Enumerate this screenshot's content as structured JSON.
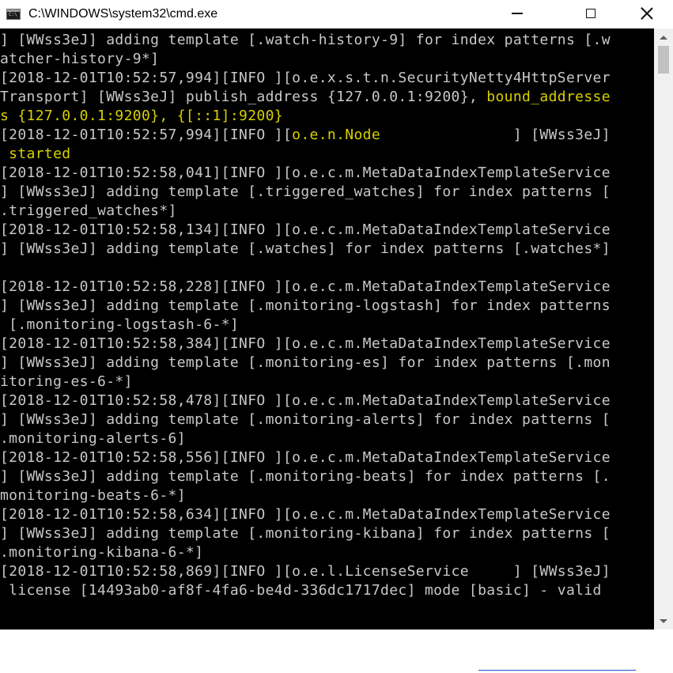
{
  "window": {
    "title": "C:\\WINDOWS\\system32\\cmd.exe",
    "icon": "cmd-icon",
    "controls": {
      "minimize": "minimize-icon",
      "maximize": "maximize-icon",
      "close": "close-icon"
    }
  },
  "colors": {
    "console_bg": "#000000",
    "console_text": "#c8c8c8",
    "highlight_text": "#d8d000"
  },
  "console": {
    "lines": [
      [
        {
          "text": "] [WWss3eJ] adding template [.watch-history-9] for index patterns [.w",
          "hl": false
        }
      ],
      [
        {
          "text": "atcher-history-9*]",
          "hl": false
        }
      ],
      [
        {
          "text": "[2018-12-01T10:52:57,994][INFO ][o.e.x.s.t.n.SecurityNetty4HttpServer",
          "hl": false
        }
      ],
      [
        {
          "text": "Transport] [WWss3eJ] publish_address {127.0.0.1:9200}, ",
          "hl": false
        },
        {
          "text": "bound_addresse",
          "hl": true
        }
      ],
      [
        {
          "text": "s {127.0.0.1:9200}, {[::1]:9200}",
          "hl": true
        }
      ],
      [
        {
          "text": "[2018-12-01T10:52:57,994][INFO ][",
          "hl": false
        },
        {
          "text": "o.e.n.Node",
          "hl": true
        },
        {
          "text": "               ] [WWss3eJ]",
          "hl": false
        }
      ],
      [
        {
          "text": " started",
          "hl": true
        }
      ],
      [
        {
          "text": "[2018-12-01T10:52:58,041][INFO ][o.e.c.m.MetaDataIndexTemplateService",
          "hl": false
        }
      ],
      [
        {
          "text": "] [WWss3eJ] adding template [.triggered_watches] for index patterns [",
          "hl": false
        }
      ],
      [
        {
          "text": ".triggered_watches*]",
          "hl": false
        }
      ],
      [
        {
          "text": "[2018-12-01T10:52:58,134][INFO ][o.e.c.m.MetaDataIndexTemplateService",
          "hl": false
        }
      ],
      [
        {
          "text": "] [WWss3eJ] adding template [.watches] for index patterns [.watches*]",
          "hl": false
        }
      ],
      [
        {
          "text": "",
          "hl": false
        }
      ],
      [
        {
          "text": "[2018-12-01T10:52:58,228][INFO ][o.e.c.m.MetaDataIndexTemplateService",
          "hl": false
        }
      ],
      [
        {
          "text": "] [WWss3eJ] adding template [.monitoring-logstash] for index patterns",
          "hl": false
        }
      ],
      [
        {
          "text": " [.monitoring-logstash-6-*]",
          "hl": false
        }
      ],
      [
        {
          "text": "[2018-12-01T10:52:58,384][INFO ][o.e.c.m.MetaDataIndexTemplateService",
          "hl": false
        }
      ],
      [
        {
          "text": "] [WWss3eJ] adding template [.monitoring-es] for index patterns [.mon",
          "hl": false
        }
      ],
      [
        {
          "text": "itoring-es-6-*]",
          "hl": false
        }
      ],
      [
        {
          "text": "[2018-12-01T10:52:58,478][INFO ][o.e.c.m.MetaDataIndexTemplateService",
          "hl": false
        }
      ],
      [
        {
          "text": "] [WWss3eJ] adding template [.monitoring-alerts] for index patterns [",
          "hl": false
        }
      ],
      [
        {
          "text": ".monitoring-alerts-6]",
          "hl": false
        }
      ],
      [
        {
          "text": "[2018-12-01T10:52:58,556][INFO ][o.e.c.m.MetaDataIndexTemplateService",
          "hl": false
        }
      ],
      [
        {
          "text": "] [WWss3eJ] adding template [.monitoring-beats] for index patterns [.",
          "hl": false
        }
      ],
      [
        {
          "text": "monitoring-beats-6-*]",
          "hl": false
        }
      ],
      [
        {
          "text": "[2018-12-01T10:52:58,634][INFO ][o.e.c.m.MetaDataIndexTemplateService",
          "hl": false
        }
      ],
      [
        {
          "text": "] [WWss3eJ] adding template [.monitoring-kibana] for index patterns [",
          "hl": false
        }
      ],
      [
        {
          "text": ".monitoring-kibana-6-*]",
          "hl": false
        }
      ],
      [
        {
          "text": "[2018-12-01T10:52:58,869][INFO ][o.e.l.LicenseService     ] [WWss3eJ]",
          "hl": false
        }
      ],
      [
        {
          "text": " license [14493ab0-af8f-4fa6-be4d-336dc1717dec] mode [basic] - valid",
          "hl": false
        }
      ]
    ]
  }
}
